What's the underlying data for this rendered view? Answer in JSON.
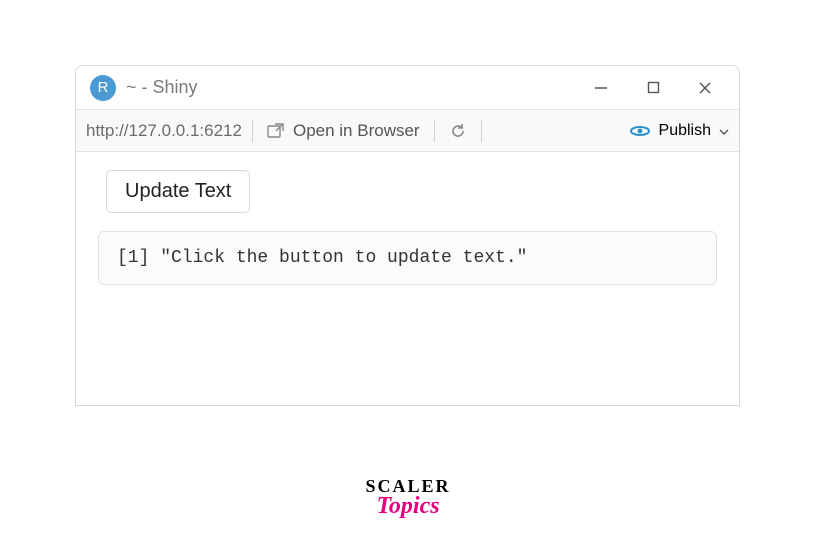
{
  "window": {
    "title": "~ - Shiny",
    "app_icon_letter": "R"
  },
  "toolbar": {
    "url": "http://127.0.0.1:6212",
    "open_browser": "Open in Browser",
    "publish": "Publish"
  },
  "content": {
    "button_label": "Update Text",
    "output_text": "[1] \"Click the button to update text.\""
  },
  "watermark": {
    "line1": "SCALER",
    "line2": "Topics"
  }
}
